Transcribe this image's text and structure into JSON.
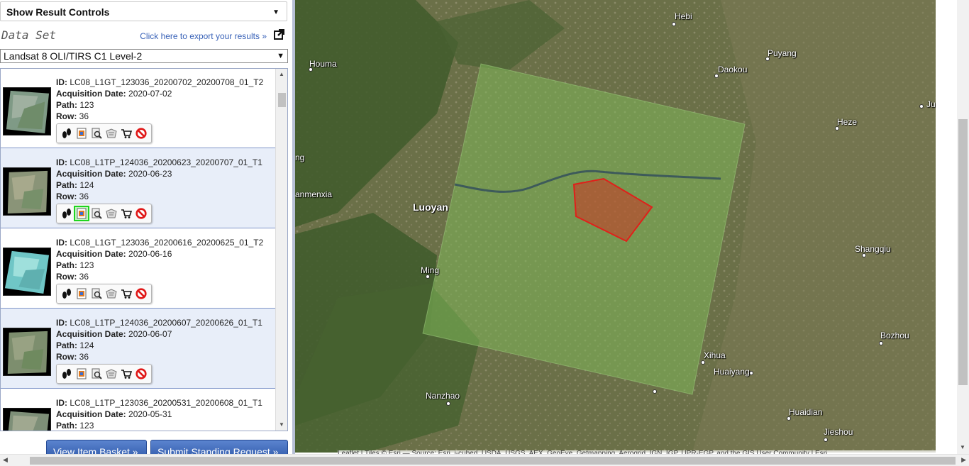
{
  "controls": {
    "label": "Show Result Controls",
    "caret": "▼"
  },
  "dataset": {
    "label": "Data Set",
    "export_link": "Click here to export your results »",
    "export_icon": "external-link-icon",
    "selected": "Landsat 8 OLI/TIRS C1 Level-2",
    "caret": "▼"
  },
  "field_labels": {
    "id": "ID:",
    "date": "Acquisition Date:",
    "path": "Path:",
    "row": "Row:"
  },
  "results": [
    {
      "id": "LC08_L1GT_123036_20200702_20200708_01_T2",
      "date": "2020-07-02",
      "path": "123",
      "row": "36"
    },
    {
      "id": "LC08_L1TP_124036_20200623_20200707_01_T1",
      "date": "2020-06-23",
      "path": "124",
      "row": "36"
    },
    {
      "id": "LC08_L1GT_123036_20200616_20200625_01_T2",
      "date": "2020-06-16",
      "path": "123",
      "row": "36"
    },
    {
      "id": "LC08_L1TP_124036_20200607_20200626_01_T1",
      "date": "2020-06-07",
      "path": "124",
      "row": "36"
    },
    {
      "id": "LC08_L1TP_123036_20200531_20200608_01_T1",
      "date": "2020-05-31",
      "path": "123",
      "row": ""
    }
  ],
  "action_icons": [
    "footprint-icon",
    "overlay-icon",
    "metadata-icon",
    "compare-icon",
    "cart-icon",
    "exclude-icon"
  ],
  "buttons": {
    "view_basket": "View Item Basket »",
    "standing_request": "Submit Standing Request »"
  },
  "map": {
    "cities": {
      "hebi": "Hebi",
      "houma": "Houma",
      "puyang": "Puyang",
      "daokou": "Daokou",
      "ju": "Ju",
      "heze": "Heze",
      "ng": "ng",
      "sanmenxia": "anmenxia",
      "luoyang": "Luoyan",
      "shangqiu": "Shangqiu",
      "mingo": "Ming",
      "bozhou": "Bozhou",
      "xihua": "Xihua",
      "huaiyang": "Huaiyang",
      "nanzhao": "Nanzhao",
      "huaidian": "Huaidian",
      "jieshou": "Jieshou"
    },
    "attribution": "Leaflet | Tiles © Esri — Source: Esri, i-cubed, USDA, USGS, AEX, GeoEye, Getmapping, Aerogrid, IGN, IGP, UPR-EGP, and the GIS User Community | Esri",
    "aoi_color": "#e0201a",
    "scene_color": "#7fb85a"
  }
}
